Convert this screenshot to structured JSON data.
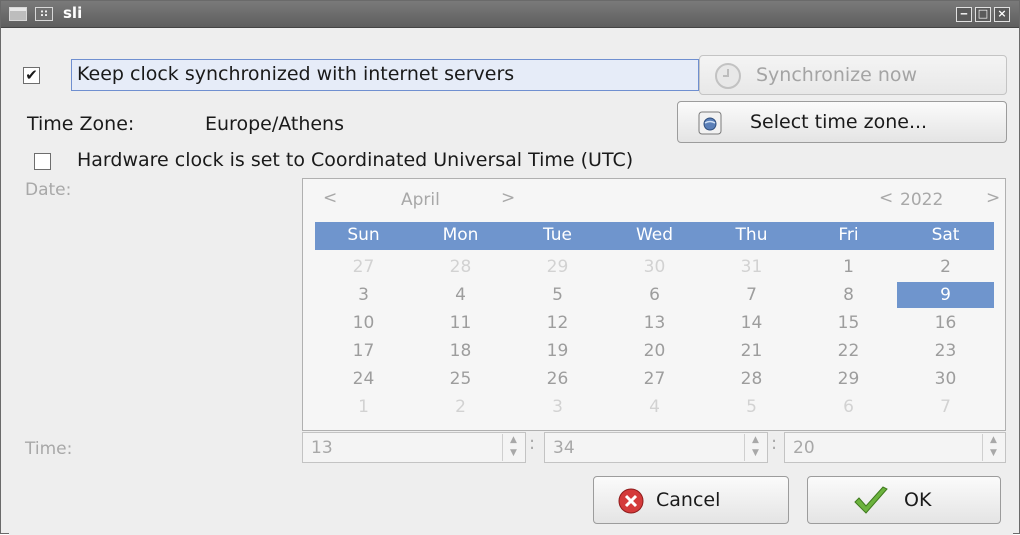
{
  "window": {
    "title": "sli",
    "app_icon_glyph": "::"
  },
  "sync": {
    "checked": true,
    "check_glyph": "✔",
    "label": "Keep clock synchronized with internet servers",
    "button": "Synchronize now",
    "button_enabled": false
  },
  "timezone": {
    "label": "Time Zone:",
    "value": "Europe/Athens",
    "button": "Select time zone..."
  },
  "hardware_clock": {
    "checked": false,
    "label": "Hardware clock is set to Coordinated Universal Time (UTC)"
  },
  "date": {
    "label": "Date:",
    "prev_month": "<",
    "month": "April",
    "next_month": ">",
    "prev_year": "<",
    "year": "2022",
    "next_year": ">",
    "weekdays": [
      "Sun",
      "Mon",
      "Tue",
      "Wed",
      "Thu",
      "Fri",
      "Sat"
    ],
    "weeks": [
      [
        "27",
        "28",
        "29",
        "30",
        "31",
        "1",
        "2"
      ],
      [
        "3",
        "4",
        "5",
        "6",
        "7",
        "8",
        "9"
      ],
      [
        "10",
        "11",
        "12",
        "13",
        "14",
        "15",
        "16"
      ],
      [
        "17",
        "18",
        "19",
        "20",
        "21",
        "22",
        "23"
      ],
      [
        "24",
        "25",
        "26",
        "27",
        "28",
        "29",
        "30"
      ],
      [
        "1",
        "2",
        "3",
        "4",
        "5",
        "6",
        "7"
      ]
    ],
    "selected_day": "9"
  },
  "time": {
    "label": "Time:",
    "hour": "13",
    "minute": "34",
    "second": "20",
    "separator": ":"
  },
  "actions": {
    "cancel": "Cancel",
    "ok": "OK"
  },
  "colors": {
    "selection": "#6f95cd",
    "cancel_icon": "#d43a3a",
    "ok_icon": "#6cb33e"
  }
}
